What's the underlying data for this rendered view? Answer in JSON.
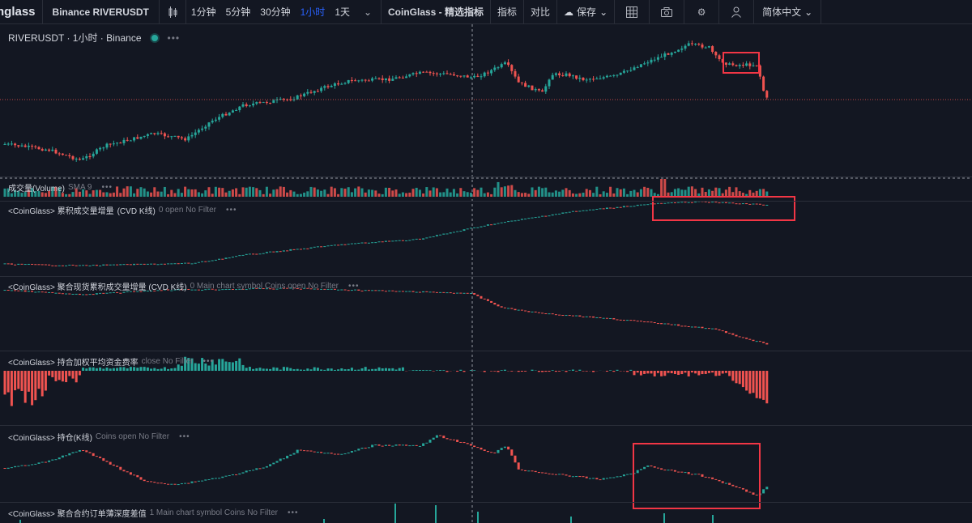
{
  "toolbar": {
    "logo": "nglass",
    "symbol": "Binance RIVERUSDT",
    "intervals": [
      "1分钟",
      "5分钟",
      "30分钟",
      "1小时",
      "1天"
    ],
    "active_interval": "1小时",
    "indicator_brand": "CoinGlass - 精选指标",
    "indicators_label": "指标",
    "compare_label": "对比",
    "save_label": "保存",
    "language_label": "简体中文"
  },
  "colors": {
    "up": "#26a69a",
    "down": "#ef5350",
    "highlight": "#f23645",
    "active": "#2962ff"
  },
  "main_pane": {
    "title": "RIVERUSDT · 1小时 · Binance"
  },
  "volume_pane": {
    "title": "成交量(Volume)",
    "sub": "SMA 9"
  },
  "cvd_pane": {
    "title": "<CoinGlass> 累积成交量增量",
    "sub1": "(CVD K线)",
    "sub2": "0 open No Filter"
  },
  "spot_cvd_pane": {
    "title": "<CoinGlass> 聚合现货累积成交量增量 (CVD K线)",
    "sub": "0 Main chart symbol Coins open No Filter"
  },
  "funding_pane": {
    "title": "<CoinGlass> 持合加权平均资金费率",
    "sub": "close No Filter"
  },
  "oi_pane": {
    "title": "<CoinGlass> 持仓(K线)",
    "sub": "Coins open No Filter"
  },
  "depth_pane": {
    "title": "<CoinGlass> 聚合合约订单薄深度差值",
    "sub": "1 Main chart symbol Coins No Filter"
  }
}
